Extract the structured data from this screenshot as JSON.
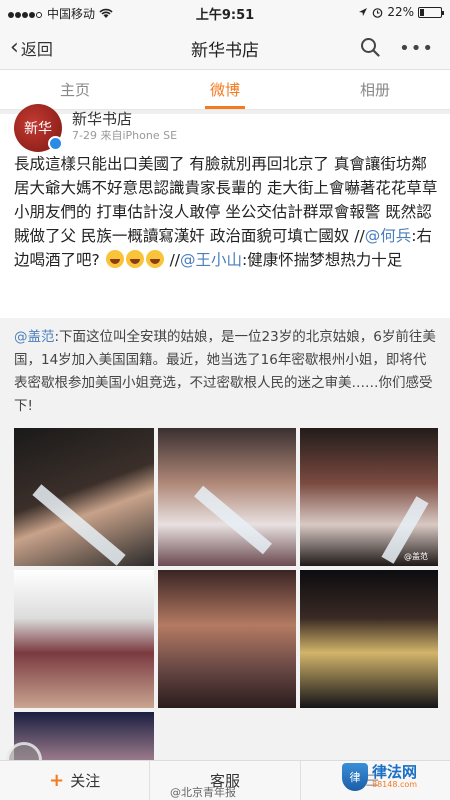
{
  "status_bar": {
    "carrier": "中国移动",
    "time": "上午9:51",
    "battery_text": "22%",
    "battery_level": 0.22
  },
  "nav": {
    "back_label": "返回",
    "title": "新华书店",
    "search_icon": "search-icon",
    "more_icon": "more-icon"
  },
  "tabs": [
    {
      "label": "主页",
      "active": false
    },
    {
      "label": "微博",
      "active": true
    },
    {
      "label": "相册",
      "active": false
    }
  ],
  "post": {
    "avatar_text": "新华",
    "username": "新华书店",
    "meta": "7-29  来自iPhone SE",
    "text_1": "長成這樣只能出口美國了 有臉就別再回北京了 真會讓街坊鄰居大爺大媽不好意思認識貴家長輩的 走大街上會嚇著花花草草小朋友們的 打車估計沒人敢停 坐公交估計群眾會報警 既然認賊做了父 民族一概讀寫漢奸 政治面貌可填亡國奴 //",
    "mention_1": "@何兵",
    "text_2": ":右边喝酒了吧? ",
    "text_3": " //",
    "mention_2": "@王小山",
    "text_4": ":健康怀揣梦想热力十足"
  },
  "repost": {
    "mention": "@盖范",
    "text": ":下面这位叫全安琪的姑娘，是一位23岁的北京姑娘，6岁前往美国，14岁加入美国国籍。最近，她当选了16年密歇根州小姐，即将代表密歇根参加美国小姐竞选，不过密歇根人民的迷之审美……你们感受下!",
    "photo_watermark": "@盖范"
  },
  "bottom_bar": {
    "follow_label": "关注",
    "service_label": "客服",
    "credit": "@北京青年报",
    "logo_main": "律法网",
    "logo_sub": "88148.com"
  },
  "colors": {
    "accent": "#f47a20",
    "link": "#4a7fbd",
    "verified": "#2b8be6"
  }
}
